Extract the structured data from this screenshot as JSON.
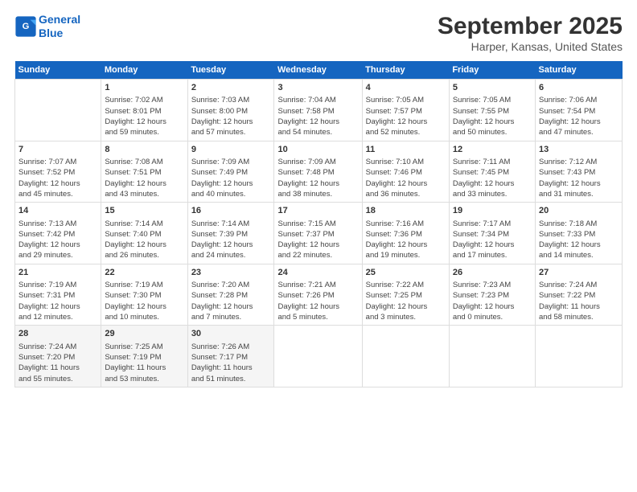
{
  "header": {
    "logo_line1": "General",
    "logo_line2": "Blue",
    "title": "September 2025",
    "subtitle": "Harper, Kansas, United States"
  },
  "days_of_week": [
    "Sunday",
    "Monday",
    "Tuesday",
    "Wednesday",
    "Thursday",
    "Friday",
    "Saturday"
  ],
  "weeks": [
    [
      {
        "day": "",
        "info": ""
      },
      {
        "day": "1",
        "info": "Sunrise: 7:02 AM\nSunset: 8:01 PM\nDaylight: 12 hours\nand 59 minutes."
      },
      {
        "day": "2",
        "info": "Sunrise: 7:03 AM\nSunset: 8:00 PM\nDaylight: 12 hours\nand 57 minutes."
      },
      {
        "day": "3",
        "info": "Sunrise: 7:04 AM\nSunset: 7:58 PM\nDaylight: 12 hours\nand 54 minutes."
      },
      {
        "day": "4",
        "info": "Sunrise: 7:05 AM\nSunset: 7:57 PM\nDaylight: 12 hours\nand 52 minutes."
      },
      {
        "day": "5",
        "info": "Sunrise: 7:05 AM\nSunset: 7:55 PM\nDaylight: 12 hours\nand 50 minutes."
      },
      {
        "day": "6",
        "info": "Sunrise: 7:06 AM\nSunset: 7:54 PM\nDaylight: 12 hours\nand 47 minutes."
      }
    ],
    [
      {
        "day": "7",
        "info": "Sunrise: 7:07 AM\nSunset: 7:52 PM\nDaylight: 12 hours\nand 45 minutes."
      },
      {
        "day": "8",
        "info": "Sunrise: 7:08 AM\nSunset: 7:51 PM\nDaylight: 12 hours\nand 43 minutes."
      },
      {
        "day": "9",
        "info": "Sunrise: 7:09 AM\nSunset: 7:49 PM\nDaylight: 12 hours\nand 40 minutes."
      },
      {
        "day": "10",
        "info": "Sunrise: 7:09 AM\nSunset: 7:48 PM\nDaylight: 12 hours\nand 38 minutes."
      },
      {
        "day": "11",
        "info": "Sunrise: 7:10 AM\nSunset: 7:46 PM\nDaylight: 12 hours\nand 36 minutes."
      },
      {
        "day": "12",
        "info": "Sunrise: 7:11 AM\nSunset: 7:45 PM\nDaylight: 12 hours\nand 33 minutes."
      },
      {
        "day": "13",
        "info": "Sunrise: 7:12 AM\nSunset: 7:43 PM\nDaylight: 12 hours\nand 31 minutes."
      }
    ],
    [
      {
        "day": "14",
        "info": "Sunrise: 7:13 AM\nSunset: 7:42 PM\nDaylight: 12 hours\nand 29 minutes."
      },
      {
        "day": "15",
        "info": "Sunrise: 7:14 AM\nSunset: 7:40 PM\nDaylight: 12 hours\nand 26 minutes."
      },
      {
        "day": "16",
        "info": "Sunrise: 7:14 AM\nSunset: 7:39 PM\nDaylight: 12 hours\nand 24 minutes."
      },
      {
        "day": "17",
        "info": "Sunrise: 7:15 AM\nSunset: 7:37 PM\nDaylight: 12 hours\nand 22 minutes."
      },
      {
        "day": "18",
        "info": "Sunrise: 7:16 AM\nSunset: 7:36 PM\nDaylight: 12 hours\nand 19 minutes."
      },
      {
        "day": "19",
        "info": "Sunrise: 7:17 AM\nSunset: 7:34 PM\nDaylight: 12 hours\nand 17 minutes."
      },
      {
        "day": "20",
        "info": "Sunrise: 7:18 AM\nSunset: 7:33 PM\nDaylight: 12 hours\nand 14 minutes."
      }
    ],
    [
      {
        "day": "21",
        "info": "Sunrise: 7:19 AM\nSunset: 7:31 PM\nDaylight: 12 hours\nand 12 minutes."
      },
      {
        "day": "22",
        "info": "Sunrise: 7:19 AM\nSunset: 7:30 PM\nDaylight: 12 hours\nand 10 minutes."
      },
      {
        "day": "23",
        "info": "Sunrise: 7:20 AM\nSunset: 7:28 PM\nDaylight: 12 hours\nand 7 minutes."
      },
      {
        "day": "24",
        "info": "Sunrise: 7:21 AM\nSunset: 7:26 PM\nDaylight: 12 hours\nand 5 minutes."
      },
      {
        "day": "25",
        "info": "Sunrise: 7:22 AM\nSunset: 7:25 PM\nDaylight: 12 hours\nand 3 minutes."
      },
      {
        "day": "26",
        "info": "Sunrise: 7:23 AM\nSunset: 7:23 PM\nDaylight: 12 hours\nand 0 minutes."
      },
      {
        "day": "27",
        "info": "Sunrise: 7:24 AM\nSunset: 7:22 PM\nDaylight: 11 hours\nand 58 minutes."
      }
    ],
    [
      {
        "day": "28",
        "info": "Sunrise: 7:24 AM\nSunset: 7:20 PM\nDaylight: 11 hours\nand 55 minutes."
      },
      {
        "day": "29",
        "info": "Sunrise: 7:25 AM\nSunset: 7:19 PM\nDaylight: 11 hours\nand 53 minutes."
      },
      {
        "day": "30",
        "info": "Sunrise: 7:26 AM\nSunset: 7:17 PM\nDaylight: 11 hours\nand 51 minutes."
      },
      {
        "day": "",
        "info": ""
      },
      {
        "day": "",
        "info": ""
      },
      {
        "day": "",
        "info": ""
      },
      {
        "day": "",
        "info": ""
      }
    ]
  ]
}
